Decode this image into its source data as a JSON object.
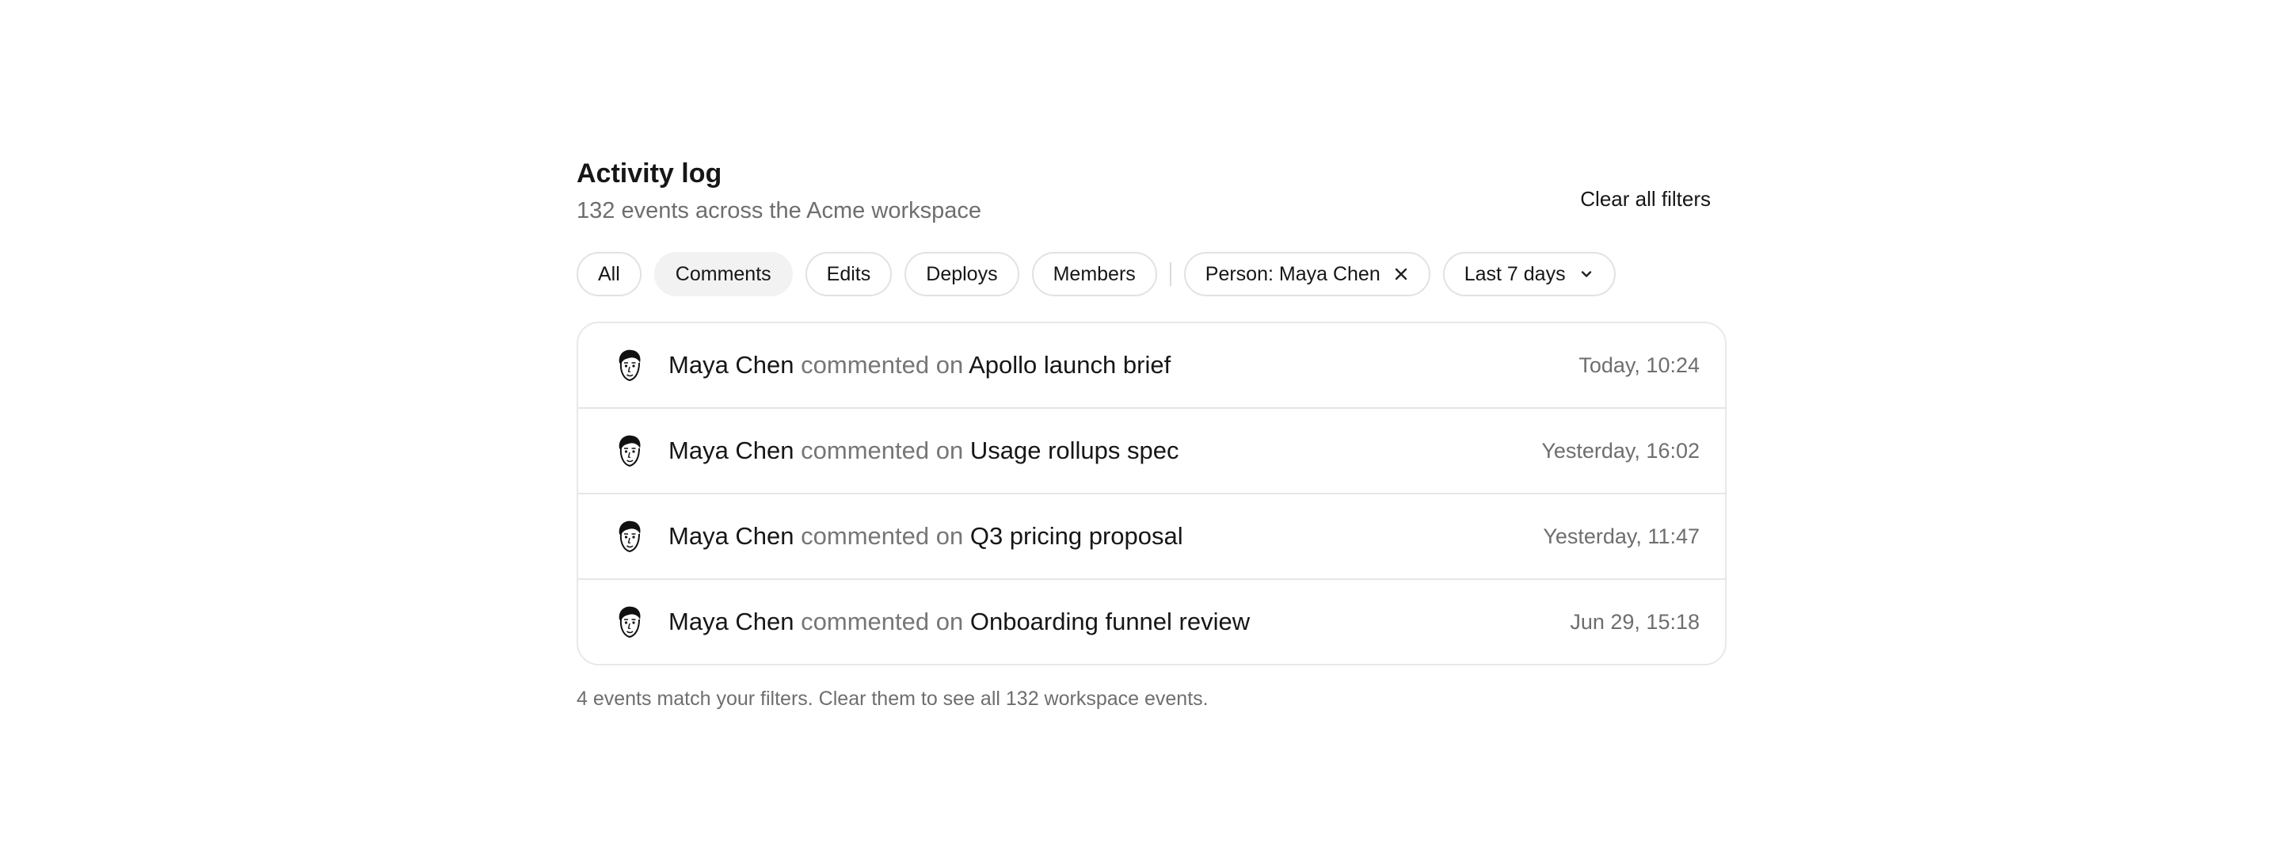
{
  "header": {
    "title": "Activity log",
    "subtitle": "132 events across the Acme workspace",
    "clear_all_label": "Clear all filters"
  },
  "filters": {
    "chips": [
      {
        "label": "All",
        "active": false
      },
      {
        "label": "Comments",
        "active": true
      },
      {
        "label": "Edits",
        "active": false
      },
      {
        "label": "Deploys",
        "active": false
      },
      {
        "label": "Members",
        "active": false
      }
    ],
    "person_filter_label": "Person: Maya Chen",
    "date_filter_label": "Last 7 days"
  },
  "events": [
    {
      "actor": "Maya Chen",
      "verb": "commented on",
      "target": "Apollo launch brief",
      "time": "Today, 10:24"
    },
    {
      "actor": "Maya Chen",
      "verb": "commented on",
      "target": "Usage rollups spec",
      "time": "Yesterday, 16:02"
    },
    {
      "actor": "Maya Chen",
      "verb": "commented on",
      "target": "Q3 pricing proposal",
      "time": "Yesterday, 11:47"
    },
    {
      "actor": "Maya Chen",
      "verb": "commented on",
      "target": "Onboarding funnel review",
      "time": "Jun 29, 15:18"
    }
  ],
  "footer": {
    "text": "4 events match your filters. Clear them to see all 132 workspace events."
  },
  "icons": {
    "avatar": "avatar-face-icon",
    "remove_filter": "close-icon",
    "dropdown": "chevron-down-icon"
  }
}
